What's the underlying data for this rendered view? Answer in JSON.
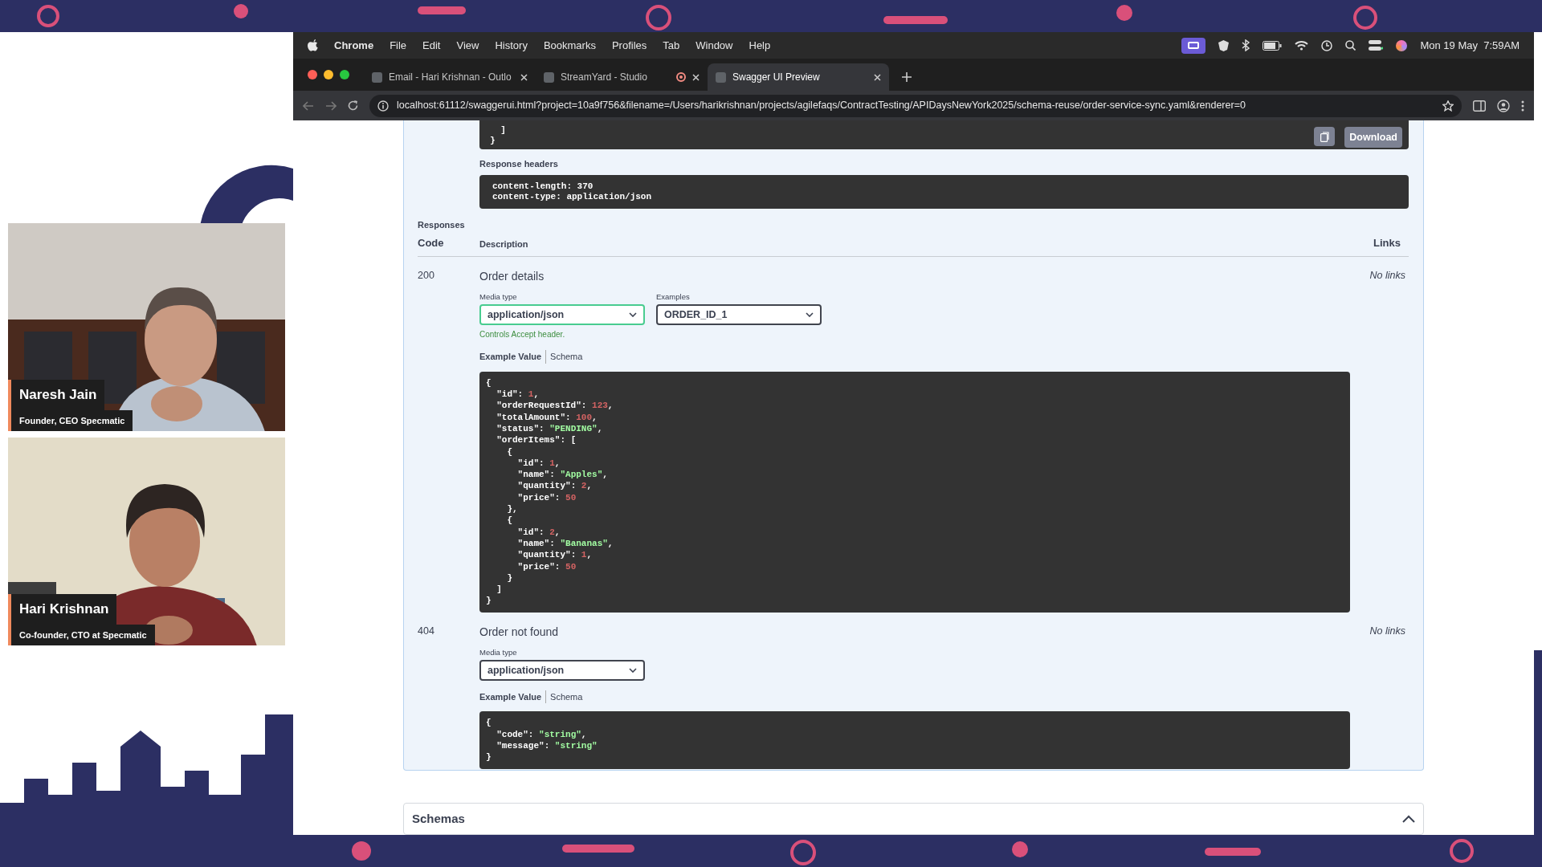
{
  "menu_bar": {
    "app": "Chrome",
    "items": [
      "File",
      "Edit",
      "View",
      "History",
      "Bookmarks",
      "Profiles",
      "Tab",
      "Window",
      "Help"
    ],
    "clock": "Mon 19 May  7:59AM"
  },
  "tabs": [
    {
      "label": "Email - Hari Krishnan - Outlo",
      "selected": false,
      "recording": false
    },
    {
      "label": "StreamYard - Studio",
      "selected": false,
      "recording": true
    },
    {
      "label": "Swagger UI Preview",
      "selected": true,
      "recording": false
    }
  ],
  "address_bar": {
    "url": "localhost:61112/swaggerui.html?project=10a9f756&filename=/Users/harikrishnan/projects/agilefaqs/ContractTesting/APIDaysNewYork2025/schema-reuse/order-service-sync.yaml&renderer=0"
  },
  "previous_response": {
    "body": "  ]\n}",
    "download_label": "Download",
    "headers_title": "Response headers",
    "headers": "content-length: 370\ncontent-type: application/json"
  },
  "responses": {
    "title": "Responses",
    "columns": [
      "Code",
      "Description",
      "Links"
    ],
    "rows": [
      {
        "code": "200",
        "description": "Order details",
        "links": "No links",
        "media_type_label": "Media type",
        "media_type": "application/json",
        "examples_label": "Examples",
        "example": "ORDER_ID_1",
        "hint": "Controls Accept header.",
        "tabs": [
          {
            "label": "Example Value",
            "selected": true
          },
          {
            "label": "Schema",
            "selected": false
          }
        ],
        "body": "{\n  \"id\": 1,\n  \"orderRequestId\": 123,\n  \"totalAmount\": 100,\n  \"status\": \"PENDING\",\n  \"orderItems\": [\n    {\n      \"id\": 1,\n      \"name\": \"Apples\",\n      \"quantity\": 2,\n      \"price\": 50\n    },\n    {\n      \"id\": 2,\n      \"name\": \"Bananas\",\n      \"quantity\": 1,\n      \"price\": 50\n    }\n  ]\n}"
      },
      {
        "code": "404",
        "description": "Order not found",
        "links": "No links",
        "media_type_label": "Media type",
        "media_type": "application/json",
        "tabs": [
          {
            "label": "Example Value",
            "selected": true
          },
          {
            "label": "Schema",
            "selected": false
          }
        ],
        "body": "{\n  \"code\": \"string\",\n  \"message\": \"string\"\n}"
      }
    ]
  },
  "schemas": {
    "title": "Schemas",
    "expanded": true
  },
  "participants": [
    {
      "name": "Naresh Jain",
      "role": "Founder, CEO Specmatic",
      "kind": "picture"
    },
    {
      "name": "Hari Krishnan",
      "role": "Co-founder, CTO at Specmatic",
      "kind": "picture"
    }
  ]
}
